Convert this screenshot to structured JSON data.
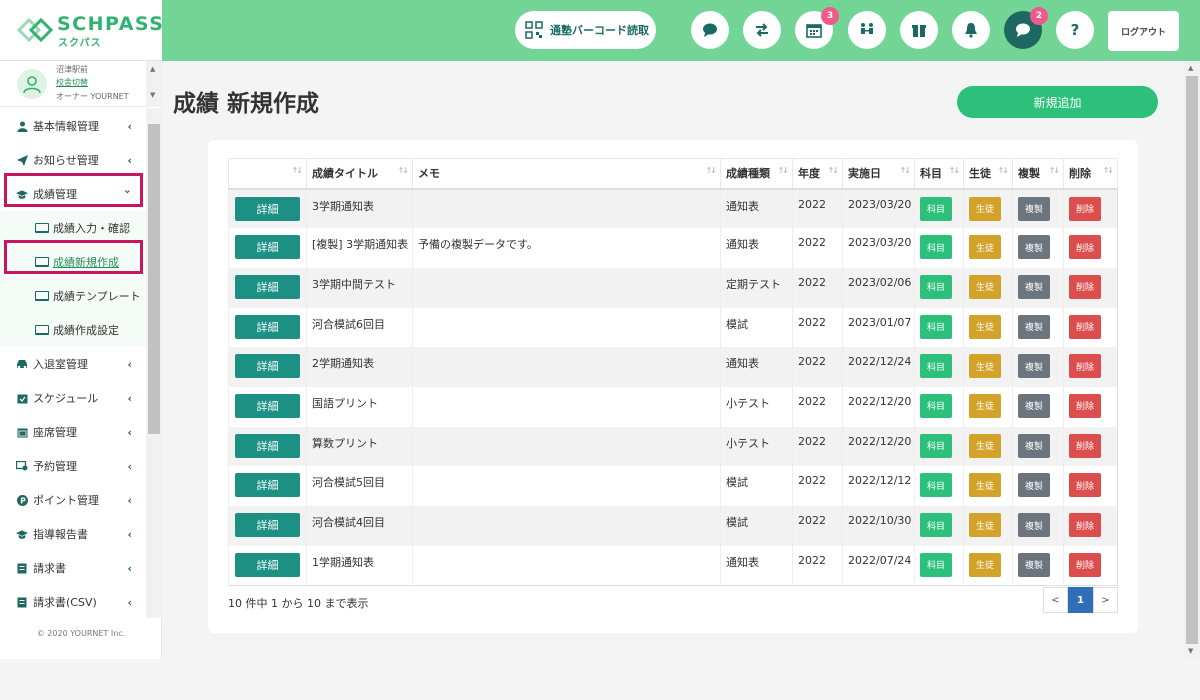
{
  "brand": {
    "name": "SCHPASS",
    "sub": "スクパス"
  },
  "header": {
    "barcode_label": "通塾バーコード読取",
    "calendar_badge": "3",
    "chat_badge": "2",
    "help_label": "?",
    "logout_label": "ログアウト"
  },
  "user": {
    "school": "沼津駅前",
    "switch_label": "校舎切替",
    "role": "オーナー YOURNET"
  },
  "sidebar": {
    "items": [
      {
        "label": "基本情報管理",
        "icon": "user-icon"
      },
      {
        "label": "お知らせ管理",
        "icon": "paper-plane-icon"
      },
      {
        "label": "成績管理",
        "icon": "graduation-cap-icon"
      },
      {
        "label": "入退室管理",
        "icon": "car-icon"
      },
      {
        "label": "スケジュール",
        "icon": "calendar-check-icon"
      },
      {
        "label": "座席管理",
        "icon": "calendar-grid-icon"
      },
      {
        "label": "予約管理",
        "icon": "reservation-icon"
      },
      {
        "label": "ポイント管理",
        "icon": "point-icon"
      },
      {
        "label": "指導報告書",
        "icon": "graduation-cap-icon"
      },
      {
        "label": "請求書",
        "icon": "invoice-icon"
      },
      {
        "label": "請求書(CSV)",
        "icon": "invoice-icon"
      }
    ],
    "subitems": [
      {
        "label": "成績入力・確認"
      },
      {
        "label": "成績新規作成"
      },
      {
        "label": "成績テンプレート"
      },
      {
        "label": "成績作成設定"
      }
    ],
    "copyright": "© 2020 YOURNET Inc."
  },
  "main": {
    "title": "成績 新規作成",
    "add_button": "新規追加",
    "table": {
      "headers": [
        "",
        "成績タイトル",
        "メモ",
        "成績種類",
        "年度",
        "実施日",
        "科目",
        "生徒",
        "複製",
        "削除"
      ],
      "btn": {
        "detail": "詳細",
        "subject": "科目",
        "student": "生徒",
        "copy": "複製",
        "delete": "削除"
      },
      "rows": [
        {
          "title": "3学期通知表",
          "memo": "",
          "type": "通知表",
          "year": "2022",
          "date": "2023/03/20"
        },
        {
          "title": "[複製] 3学期通知表",
          "memo": "予備の複製データです。",
          "type": "通知表",
          "year": "2022",
          "date": "2023/03/20"
        },
        {
          "title": "3学期中間テスト",
          "memo": "",
          "type": "定期テスト",
          "year": "2022",
          "date": "2023/02/06"
        },
        {
          "title": "河合模試6回目",
          "memo": "",
          "type": "模試",
          "year": "2022",
          "date": "2023/01/07"
        },
        {
          "title": "2学期通知表",
          "memo": "",
          "type": "通知表",
          "year": "2022",
          "date": "2022/12/24"
        },
        {
          "title": "国語プリント",
          "memo": "",
          "type": "小テスト",
          "year": "2022",
          "date": "2022/12/20"
        },
        {
          "title": "算数プリント",
          "memo": "",
          "type": "小テスト",
          "year": "2022",
          "date": "2022/12/20"
        },
        {
          "title": "河合模試5回目",
          "memo": "",
          "type": "模試",
          "year": "2022",
          "date": "2022/12/12"
        },
        {
          "title": "河合模試4回目",
          "memo": "",
          "type": "模試",
          "year": "2022",
          "date": "2022/10/30"
        },
        {
          "title": "1学期通知表",
          "memo": "",
          "type": "通知表",
          "year": "2022",
          "date": "2022/07/24"
        }
      ]
    },
    "info": "10 件中 1 から 10 まで表示",
    "pager": {
      "prev": "<",
      "current": "1",
      "next": ">"
    }
  },
  "colors": {
    "header": "#72d596",
    "accent": "#2dc07b",
    "detail": "#1d9084",
    "highlight": "#c7165f"
  }
}
